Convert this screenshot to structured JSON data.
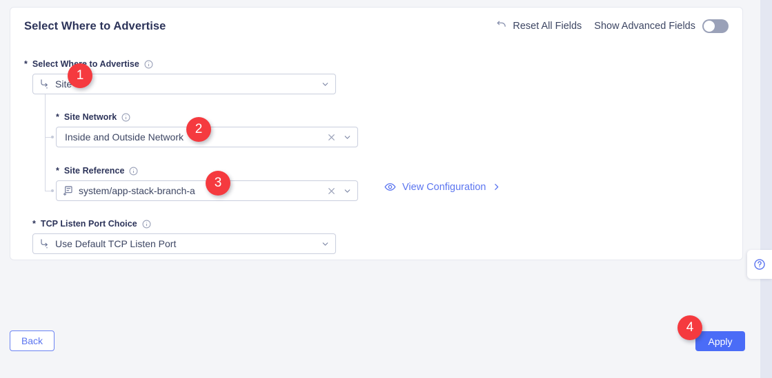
{
  "card": {
    "title": "Select Where to Advertise",
    "header": {
      "reset_label": "Reset All Fields",
      "reset_icon": "reset-arrow-icon",
      "advanced_label": "Show Advanced Fields",
      "advanced_toggle_state": "off"
    }
  },
  "fields": [
    {
      "label": "Select Where to Advertise",
      "required_marker": "*",
      "info_icon": "info-circle-icon",
      "value": "Site",
      "lead_icon": "branch-fork-icon",
      "has_clear": false,
      "chevron_icon": "chevron-down-icon"
    },
    {
      "label": "Site Network",
      "required_marker": "*",
      "info_icon": "info-circle-icon",
      "value": "Inside and Outside Network",
      "lead_icon": "none",
      "has_clear": true,
      "clear_icon": "close-x-icon",
      "chevron_icon": "chevron-down-icon"
    },
    {
      "label": "Site Reference",
      "required_marker": "*",
      "info_icon": "info-circle-icon",
      "value": "system/app-stack-branch-a",
      "lead_icon": "document-list-icon",
      "has_clear": true,
      "clear_icon": "close-x-icon",
      "chevron_icon": "chevron-down-icon"
    },
    {
      "label": "TCP Listen Port Choice",
      "required_marker": "*",
      "info_icon": "info-circle-icon",
      "value": "Use Default TCP Listen Port",
      "lead_icon": "branch-fork-icon",
      "has_clear": false,
      "chevron_icon": "chevron-down-icon"
    }
  ],
  "view_configuration": {
    "label": "View Configuration",
    "eye_icon": "eye-icon",
    "chevron_icon": "chevron-right-icon"
  },
  "help": {
    "icon": "question-circle-icon"
  },
  "footer": {
    "back_label": "Back",
    "apply_label": "Apply"
  },
  "badges": [
    {
      "number": "1"
    },
    {
      "number": "2"
    },
    {
      "number": "3"
    },
    {
      "number": "4"
    }
  ],
  "colors": {
    "accent_blue": "#4a6cf7",
    "link_blue": "#5b75f0",
    "badge_red": "#f53a3f",
    "text_dark": "#2c3359",
    "page_bg": "#f4f5f8"
  }
}
